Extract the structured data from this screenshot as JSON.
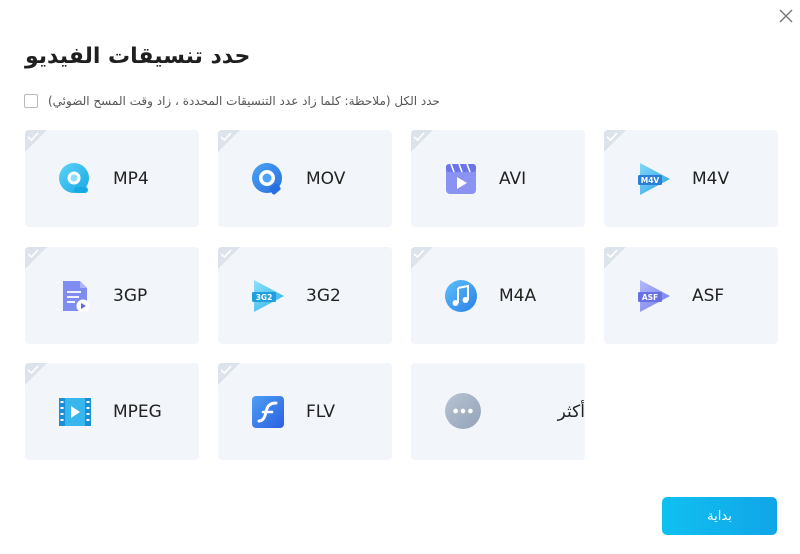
{
  "dialog": {
    "title": "حدد تنسيقات الفيديو",
    "select_all_label": "حدد الكل (ملاحظة: كلما زاد عدد التنسيقات المحددة ، زاد وقت المسح الضوئي)",
    "start_label": "بداية"
  },
  "formats": [
    {
      "label": "MP4",
      "icon": "mp4-icon"
    },
    {
      "label": "MOV",
      "icon": "mov-icon"
    },
    {
      "label": "AVI",
      "icon": "avi-icon"
    },
    {
      "label": "M4V",
      "icon": "m4v-icon",
      "badge": "M4V"
    },
    {
      "label": "3GP",
      "icon": "3gp-icon"
    },
    {
      "label": "3G2",
      "icon": "3g2-icon",
      "badge": "3G2"
    },
    {
      "label": "M4A",
      "icon": "m4a-icon"
    },
    {
      "label": "ASF",
      "icon": "asf-icon",
      "badge": "ASF"
    },
    {
      "label": "MPEG",
      "icon": "mpeg-icon"
    },
    {
      "label": "FLV",
      "icon": "flv-icon"
    }
  ],
  "more": {
    "label": "أكثر",
    "icon": "more-dots-icon"
  },
  "colors": {
    "accent": "#11a5e8",
    "card_bg": "#f2f6fa",
    "corner": "#dde3ea"
  }
}
